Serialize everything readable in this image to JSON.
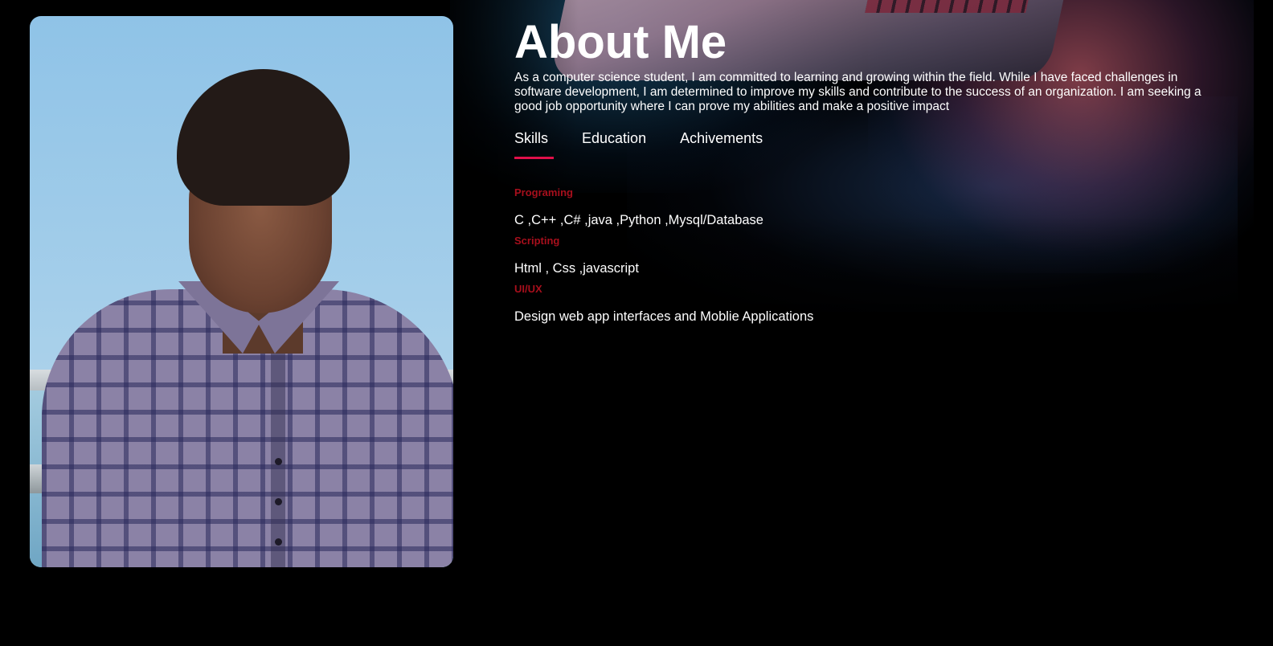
{
  "about": {
    "title": "About Me",
    "intro": "As a computer science student, I am committed to learning and growing within the field. While I have faced challenges in software development, I am determined to improve my skills and contribute to the success of an organization. I am seeking a good job opportunity where I can prove my abilities and make a positive impact"
  },
  "tabs": [
    {
      "label": "Skills",
      "active": true
    },
    {
      "label": "Education",
      "active": false
    },
    {
      "label": "Achivements",
      "active": false
    }
  ],
  "skills": [
    {
      "heading": "Programing",
      "text": "C ,C++ ,C# ,java ,Python ,Mysql/Database"
    },
    {
      "heading": "Scripting",
      "text": "Html , Css ,javascript"
    },
    {
      "heading": "UI/UX",
      "text": "Design web app interfaces and Moblie Applications"
    }
  ],
  "colors": {
    "accent": "#e0104a",
    "skill_heading": "#a70f1c",
    "background": "#000000"
  }
}
